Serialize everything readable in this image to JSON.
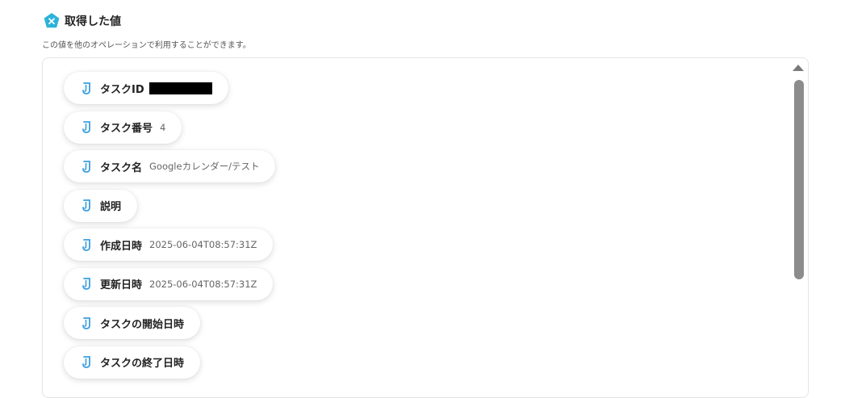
{
  "header": {
    "title": "取得した値",
    "subtitle": "この値を他のオペレーションで利用することができます。",
    "icon": "x-badge-icon",
    "icon_color": "#2bb3d9"
  },
  "fields": [
    {
      "label": "タスクID",
      "value": "",
      "redacted": true
    },
    {
      "label": "タスク番号",
      "value": "4"
    },
    {
      "label": "タスク名",
      "value": "Googleカレンダー/テスト"
    },
    {
      "label": "説明",
      "value": ""
    },
    {
      "label": "作成日時",
      "value": "2025-06-04T08:57:31Z"
    },
    {
      "label": "更新日時",
      "value": "2025-06-04T08:57:31Z"
    },
    {
      "label": "タスクの開始日時",
      "value": ""
    },
    {
      "label": "タスクの終了日時",
      "value": ""
    }
  ],
  "field_icon": "jira-icon",
  "field_icon_color": "#3b9fe0"
}
